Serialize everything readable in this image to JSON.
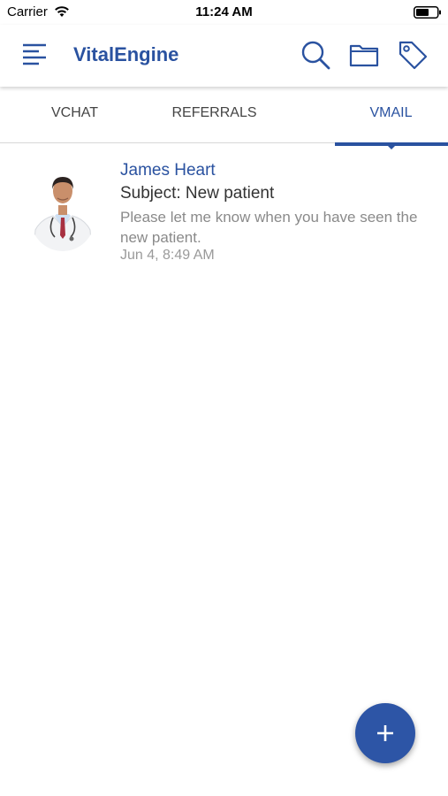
{
  "status_bar": {
    "carrier": "Carrier",
    "time": "11:24 AM"
  },
  "header": {
    "title": "VitalEngine",
    "icons": [
      "menu-icon",
      "search-icon",
      "folder-icon",
      "tag-icon"
    ]
  },
  "tabs": [
    {
      "label": "VCHAT",
      "active": false
    },
    {
      "label": "REFERRALS",
      "active": false
    },
    {
      "label": "VMAIL",
      "active": true
    }
  ],
  "messages": [
    {
      "sender": "James Heart",
      "subject": "Subject: New patient",
      "preview": "Please let me know when you have seen the new patient.",
      "timestamp": "Jun 4, 8:49 AM"
    }
  ],
  "fab": {
    "icon": "plus-icon"
  },
  "colors": {
    "accent": "#2a52a0",
    "fab": "#2d55a6",
    "muted_text": "#8a8a8a"
  }
}
